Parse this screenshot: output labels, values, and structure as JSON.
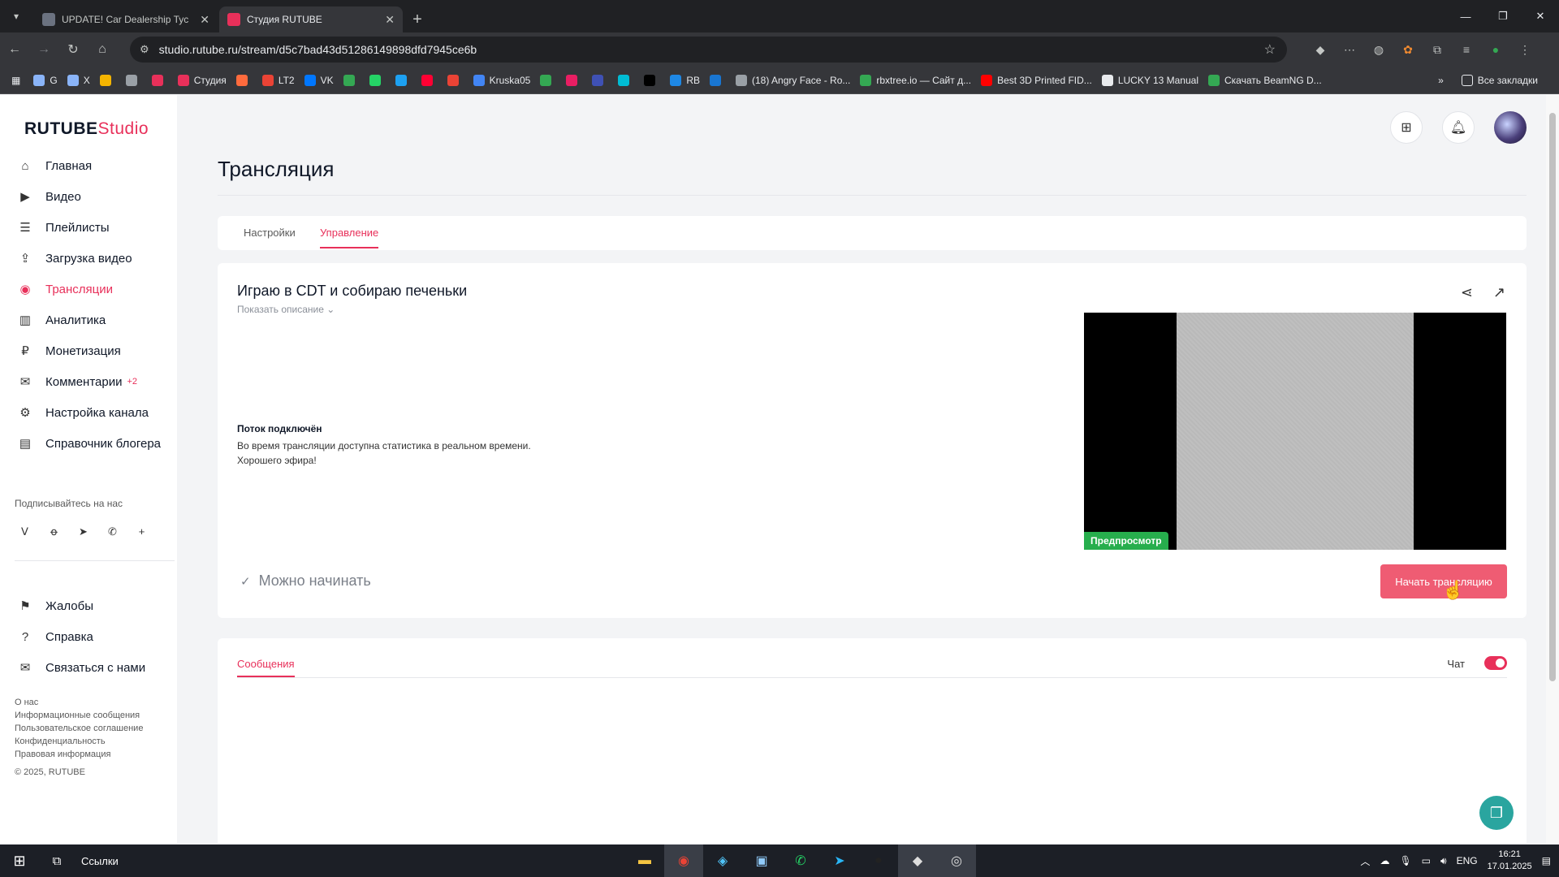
{
  "browser": {
    "tabs": [
      {
        "title": "UPDATE! Car Dealership Tyc",
        "active": false,
        "favicon_color": "#6b7280"
      },
      {
        "title": "Студия RUTUBE",
        "active": true,
        "favicon_color": "#e8305a"
      }
    ],
    "url_site_icon": "site-settings-icon",
    "url": "studio.rutube.ru/stream/d5c7bad43d51286149898dfd7945ce6b",
    "bookmarks": [
      {
        "label": "G",
        "color": "#8ab4f8"
      },
      {
        "label": "X",
        "color": "#8ab4f8"
      },
      {
        "label": "",
        "color": "#f4b400"
      },
      {
        "label": "",
        "color": "#9aa0a6"
      },
      {
        "label": "",
        "color": "#e8305a"
      },
      {
        "label": "Студия",
        "color": "#e8305a"
      },
      {
        "label": "",
        "color": "#ff6b3d"
      },
      {
        "label": "LT2",
        "color": "#ea4335"
      },
      {
        "label": "VK",
        "color": "#0077ff"
      },
      {
        "label": "",
        "color": "#34a853"
      },
      {
        "label": "",
        "color": "#25d366"
      },
      {
        "label": "",
        "color": "#1da1f2"
      },
      {
        "label": "",
        "color": "#ff0033"
      },
      {
        "label": "",
        "color": "#ea4335"
      },
      {
        "label": "Kruska05",
        "color": "#4285f4"
      },
      {
        "label": "",
        "color": "#34a853"
      },
      {
        "label": "",
        "color": "#e91e63"
      },
      {
        "label": "",
        "color": "#3f51b5"
      },
      {
        "label": "",
        "color": "#00bcd4"
      },
      {
        "label": "",
        "color": "#000000"
      },
      {
        "label": "RB",
        "color": "#1e88e5"
      },
      {
        "label": "",
        "color": "#1976d2"
      },
      {
        "label": "(18) Angry Face - Ro...",
        "color": "#9aa0a6"
      },
      {
        "label": "rbxtree.io — Сайт д...",
        "color": "#34a853"
      },
      {
        "label": "Best 3D Printed FID...",
        "color": "#ff0000"
      },
      {
        "label": "LUCKY 13 Manual",
        "color": "#e8eaed"
      },
      {
        "label": "Скачать BeamNG D...",
        "color": "#34a853"
      }
    ],
    "bookmarks_all": "Все закладки"
  },
  "sidebar": {
    "logo_main": "RUTUBE",
    "logo_sub": "Studio",
    "nav": [
      {
        "label": "Главная",
        "icon": "home-icon",
        "glyph": "⌂",
        "active": false,
        "badge": ""
      },
      {
        "label": "Видео",
        "icon": "video-icon",
        "glyph": "▶",
        "active": false,
        "badge": ""
      },
      {
        "label": "Плейлисты",
        "icon": "playlist-icon",
        "glyph": "☰",
        "active": false,
        "badge": ""
      },
      {
        "label": "Загрузка видео",
        "icon": "upload-icon",
        "glyph": "⇪",
        "active": false,
        "badge": ""
      },
      {
        "label": "Трансляции",
        "icon": "broadcast-icon",
        "glyph": "◉",
        "active": true,
        "badge": ""
      },
      {
        "label": "Аналитика",
        "icon": "analytics-icon",
        "glyph": "▥",
        "active": false,
        "badge": ""
      },
      {
        "label": "Монетизация",
        "icon": "ruble-icon",
        "glyph": "₽",
        "active": false,
        "badge": ""
      },
      {
        "label": "Комментарии",
        "icon": "comments-icon",
        "glyph": "✉",
        "active": false,
        "badge": "+2"
      },
      {
        "label": "Настройка канала",
        "icon": "gear-icon",
        "glyph": "⚙",
        "active": false,
        "badge": ""
      },
      {
        "label": "Справочник блогера",
        "icon": "book-icon",
        "glyph": "▤",
        "active": false,
        "badge": ""
      }
    ],
    "follow_label": "Подписывайтесь на нас",
    "socials": [
      {
        "name": "vk-icon",
        "glyph": "ᐯ"
      },
      {
        "name": "odnoklassniki-icon",
        "glyph": "ꝋ"
      },
      {
        "name": "telegram-icon",
        "glyph": "➤"
      },
      {
        "name": "viber-icon",
        "glyph": "✆"
      },
      {
        "name": "more-icon",
        "glyph": "+"
      }
    ],
    "nav2": [
      {
        "label": "Жалобы",
        "icon": "flag-icon",
        "glyph": "⚑"
      },
      {
        "label": "Справка",
        "icon": "help-icon",
        "glyph": "?"
      },
      {
        "label": "Связаться с нами",
        "icon": "mail-icon",
        "glyph": "✉"
      }
    ],
    "footer_links": [
      "О нас",
      "Информационные сообщения",
      "Пользовательское соглашение",
      "Конфиденциальность",
      "Правовая информация"
    ],
    "copyright": "© 2025, RUTUBE"
  },
  "header": {
    "page_title": "Трансляция",
    "tabs": [
      {
        "label": "Настройки",
        "active": false
      },
      {
        "label": "Управление",
        "active": true
      }
    ]
  },
  "stream": {
    "title": "Играю в CDT и собираю печеньки",
    "show_description": "Показать описание",
    "status_title": "Поток подключён",
    "status_text_1": "Во время трансляции доступна статистика в реальном времени.",
    "status_text_2": "Хорошего эфира!",
    "preview_label": "Предпросмотр",
    "ready_label": "Можно начинать",
    "start_button": "Начать трансляцию"
  },
  "chat": {
    "messages_tab": "Сообщения",
    "chat_label": "Чат",
    "chat_enabled": true
  },
  "taskbar": {
    "links_label": "Ссылки",
    "language": "ENG",
    "time": "16:21",
    "date": "17.01.2025"
  },
  "colors": {
    "accent": "#e8305a",
    "start_button": "#ef5c73",
    "preview_badge": "#27ae4d",
    "help_fab": "#2aa59f"
  }
}
